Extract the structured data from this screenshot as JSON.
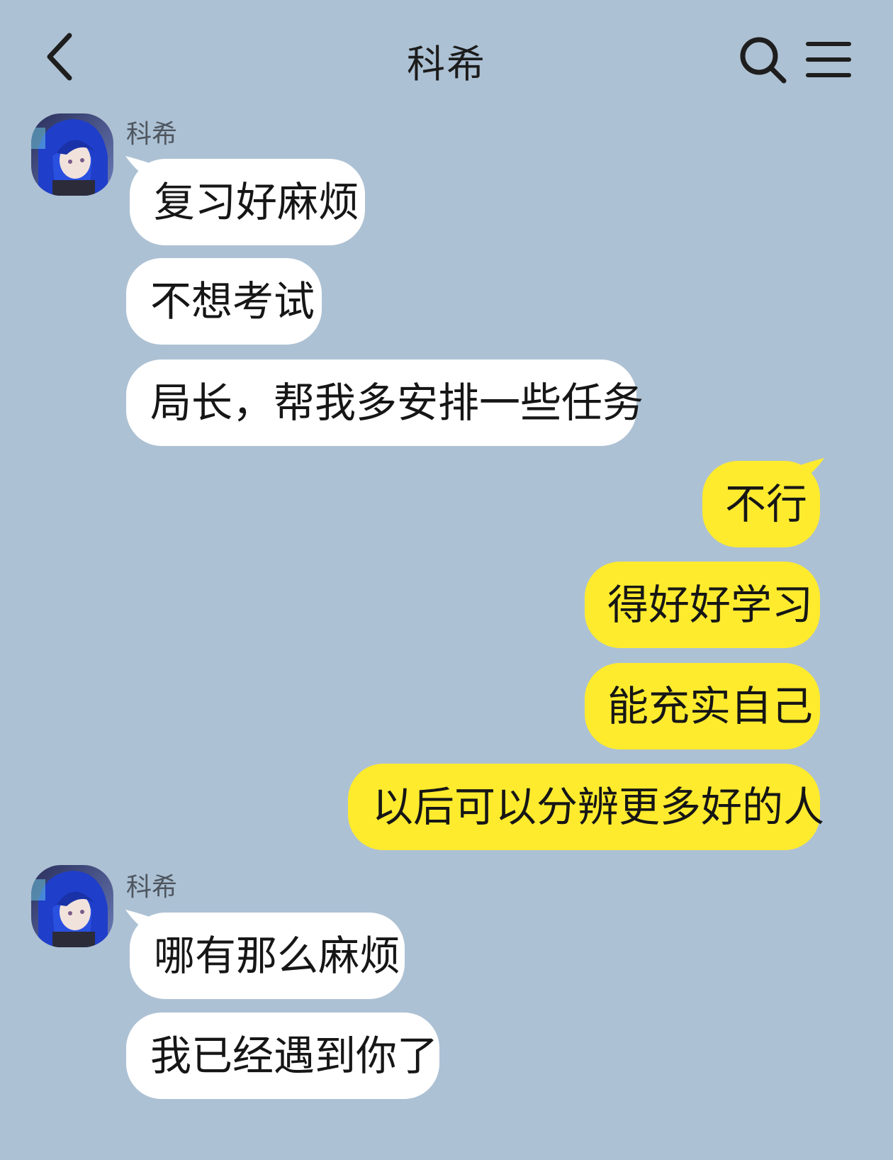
{
  "header": {
    "title": "科希",
    "back_icon": "chevron-left-icon",
    "search_icon": "search-icon",
    "menu_icon": "menu-icon"
  },
  "colors": {
    "background": "#adc1d4",
    "incoming_bubble": "#ffffff",
    "outgoing_bubble": "#ffeb2e"
  },
  "messages": [
    {
      "type": "sender",
      "name": "科希"
    },
    {
      "type": "incoming",
      "text": "复习好麻烦"
    },
    {
      "type": "incoming",
      "text": "不想考试"
    },
    {
      "type": "incoming",
      "text": "局长，帮我多安排一些任务"
    },
    {
      "type": "outgoing",
      "text": "不行"
    },
    {
      "type": "outgoing",
      "text": "得好好学习"
    },
    {
      "type": "outgoing",
      "text": "能充实自己"
    },
    {
      "type": "outgoing",
      "text": "以后可以分辨更多好的人"
    },
    {
      "type": "sender",
      "name": "科希"
    },
    {
      "type": "incoming",
      "text": "哪有那么麻烦"
    },
    {
      "type": "incoming",
      "text": "我已经遇到你了"
    }
  ]
}
